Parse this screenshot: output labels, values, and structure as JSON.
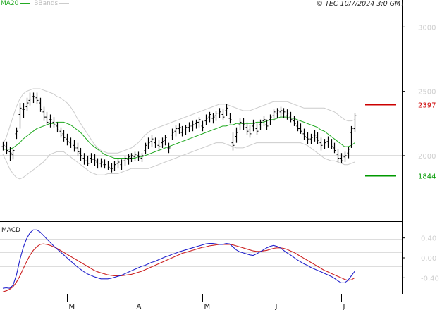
{
  "legend": {
    "ma_label": "MA20",
    "bb_label": "BBands"
  },
  "timestamp": "© TEC 10/7/2024 3:0 GMT",
  "colors": {
    "ma": "#22aa22",
    "bband": "#cccccc",
    "price": "#000000",
    "macd_line": "#2222cc",
    "signal_line": "#cc2222",
    "upper_level": "#cc0000",
    "lower_level": "#009900",
    "grid": "#dddddd"
  },
  "chart_data": [
    {
      "type": "ohlc",
      "title": "",
      "ylim": [
        14.9,
        32.1
      ],
      "yticks": [
        {
          "value": 30,
          "label": "3000"
        },
        {
          "value": 25,
          "label": "2500"
        },
        {
          "value": 20,
          "label": "2000"
        }
      ],
      "x_ticks": [
        {
          "index": 19,
          "label": "M"
        },
        {
          "index": 39,
          "label": "A"
        },
        {
          "index": 59,
          "label": "M"
        },
        {
          "index": 80,
          "label": "J"
        },
        {
          "index": 100,
          "label": "J"
        }
      ],
      "levels": [
        {
          "name": "resistance",
          "value": 23.97,
          "label": "2397",
          "color": "#cc0000"
        },
        {
          "name": "support",
          "value": 18.44,
          "label": "1844",
          "color": "#009900"
        }
      ],
      "ohlc": [
        [
          20.7,
          21.1,
          20.4,
          20.8
        ],
        [
          20.7,
          21.1,
          20.1,
          20.4
        ],
        [
          20.3,
          20.7,
          19.6,
          20.2
        ],
        [
          20.1,
          20.5,
          19.7,
          20.4
        ],
        [
          21.7,
          22.2,
          21.3,
          21.9
        ],
        [
          23.2,
          24.1,
          22.1,
          23.7
        ],
        [
          23.6,
          24.1,
          22.9,
          23.6
        ],
        [
          23.8,
          24.5,
          23.5,
          24.1
        ],
        [
          24.3,
          24.9,
          23.9,
          24.4
        ],
        [
          24.6,
          24.9,
          24.1,
          24.6
        ],
        [
          24.5,
          24.9,
          24.0,
          24.3
        ],
        [
          24.1,
          24.5,
          23.4,
          23.6
        ],
        [
          23.4,
          23.8,
          22.7,
          23.0
        ],
        [
          23.0,
          23.4,
          22.4,
          22.6
        ],
        [
          22.8,
          23.2,
          22.2,
          22.8
        ],
        [
          22.6,
          23.0,
          22.2,
          22.4
        ],
        [
          22.3,
          22.6,
          21.8,
          22.0
        ],
        [
          21.9,
          22.2,
          21.4,
          21.6
        ],
        [
          21.7,
          22.0,
          21.1,
          21.4
        ],
        [
          21.3,
          21.7,
          20.8,
          21.1
        ],
        [
          21.0,
          21.4,
          20.6,
          20.9
        ],
        [
          20.8,
          21.2,
          20.3,
          20.6
        ],
        [
          20.6,
          21.0,
          20.0,
          20.3
        ],
        [
          20.2,
          20.6,
          19.6,
          20.0
        ],
        [
          19.8,
          20.2,
          19.3,
          19.6
        ],
        [
          19.6,
          20.0,
          19.2,
          19.4
        ],
        [
          19.8,
          20.2,
          19.4,
          19.7
        ],
        [
          19.7,
          20.1,
          19.2,
          19.6
        ],
        [
          19.5,
          19.8,
          19.0,
          19.2
        ],
        [
          19.4,
          19.8,
          19.1,
          19.5
        ],
        [
          19.3,
          19.7,
          19.0,
          19.3
        ],
        [
          19.2,
          19.6,
          18.9,
          19.1
        ],
        [
          19.0,
          19.4,
          18.7,
          19.0
        ],
        [
          19.2,
          19.6,
          18.8,
          19.3
        ],
        [
          19.4,
          19.8,
          19.0,
          19.5
        ],
        [
          19.3,
          19.7,
          18.9,
          19.2
        ],
        [
          19.6,
          20.0,
          19.2,
          19.8
        ],
        [
          19.7,
          20.1,
          19.3,
          19.9
        ],
        [
          19.8,
          20.2,
          19.5,
          20.0
        ],
        [
          19.9,
          20.3,
          19.6,
          20.1
        ],
        [
          20.0,
          20.3,
          19.6,
          19.9
        ],
        [
          19.8,
          20.2,
          19.5,
          20.0
        ],
        [
          20.4,
          21.0,
          20.1,
          20.8
        ],
        [
          20.9,
          21.4,
          20.5,
          21.0
        ],
        [
          21.1,
          21.6,
          20.7,
          21.3
        ],
        [
          21.0,
          21.4,
          20.6,
          20.9
        ],
        [
          20.8,
          21.2,
          20.4,
          20.7
        ],
        [
          21.0,
          21.4,
          20.6,
          21.1
        ],
        [
          21.2,
          21.6,
          20.8,
          21.4
        ],
        [
          20.6,
          21.0,
          20.2,
          20.6
        ],
        [
          21.6,
          22.1,
          21.2,
          21.8
        ],
        [
          21.9,
          22.4,
          21.5,
          22.1
        ],
        [
          22.1,
          22.5,
          21.7,
          22.2
        ],
        [
          21.8,
          22.3,
          21.5,
          22.0
        ],
        [
          22.0,
          22.4,
          21.6,
          22.2
        ],
        [
          22.2,
          22.6,
          21.8,
          22.3
        ],
        [
          22.3,
          22.7,
          21.9,
          22.4
        ],
        [
          22.5,
          22.8,
          22.1,
          22.6
        ],
        [
          22.6,
          23.0,
          22.2,
          22.8
        ],
        [
          22.3,
          22.7,
          21.9,
          22.2
        ],
        [
          22.7,
          23.2,
          22.4,
          22.9
        ],
        [
          23.0,
          23.4,
          22.6,
          23.2
        ],
        [
          22.9,
          23.3,
          22.5,
          23.0
        ],
        [
          23.1,
          23.5,
          22.7,
          23.3
        ],
        [
          23.3,
          23.7,
          22.9,
          23.4
        ],
        [
          23.2,
          23.6,
          22.8,
          23.0
        ],
        [
          23.5,
          24.0,
          23.1,
          23.7
        ],
        [
          22.9,
          23.3,
          22.5,
          22.8
        ],
        [
          21.0,
          21.8,
          20.4,
          20.8
        ],
        [
          21.5,
          22.2,
          21.0,
          21.8
        ],
        [
          22.4,
          22.9,
          22.0,
          22.6
        ],
        [
          22.5,
          22.9,
          22.0,
          22.4
        ],
        [
          22.2,
          22.6,
          21.6,
          21.9
        ],
        [
          22.0,
          22.4,
          21.4,
          21.7
        ],
        [
          22.3,
          22.8,
          21.9,
          22.5
        ],
        [
          22.1,
          22.5,
          21.6,
          21.9
        ],
        [
          22.4,
          22.8,
          22.0,
          22.6
        ],
        [
          22.7,
          23.1,
          22.3,
          22.8
        ],
        [
          22.4,
          22.8,
          22.0,
          22.3
        ],
        [
          22.8,
          23.2,
          22.4,
          23.0
        ],
        [
          23.1,
          23.6,
          22.7,
          23.4
        ],
        [
          23.3,
          23.7,
          22.9,
          23.5
        ],
        [
          23.4,
          23.8,
          23.0,
          23.5
        ],
        [
          23.3,
          23.7,
          22.9,
          23.4
        ],
        [
          23.1,
          23.6,
          22.8,
          23.3
        ],
        [
          23.0,
          23.4,
          22.6,
          22.8
        ],
        [
          22.7,
          23.1,
          22.3,
          22.5
        ],
        [
          22.3,
          22.7,
          21.9,
          22.1
        ],
        [
          22.1,
          22.5,
          21.7,
          21.9
        ],
        [
          21.7,
          22.1,
          21.2,
          21.5
        ],
        [
          21.4,
          21.8,
          20.9,
          21.3
        ],
        [
          21.3,
          21.7,
          20.9,
          21.4
        ],
        [
          21.6,
          22.0,
          21.1,
          21.6
        ],
        [
          21.4,
          21.8,
          20.9,
          21.2
        ],
        [
          21.0,
          21.4,
          20.4,
          20.8
        ],
        [
          20.9,
          21.3,
          20.5,
          21.0
        ],
        [
          21.1,
          21.5,
          20.6,
          20.9
        ],
        [
          20.9,
          21.3,
          20.5,
          20.7
        ],
        [
          20.6,
          21.0,
          20.2,
          20.4
        ],
        [
          20.1,
          20.5,
          19.5,
          19.8
        ],
        [
          19.8,
          20.2,
          19.4,
          19.6
        ],
        [
          19.9,
          20.3,
          19.5,
          20.0
        ],
        [
          20.2,
          20.7,
          19.8,
          20.5
        ],
        [
          21.8,
          22.3,
          20.6,
          22.1
        ],
        [
          22.1,
          23.3,
          21.8,
          23.1
        ]
      ],
      "ma20": [
        20.5,
        20.5,
        20.5,
        20.6,
        20.8,
        21.0,
        21.3,
        21.5,
        21.7,
        21.9,
        22.1,
        22.2,
        22.3,
        22.4,
        22.5,
        22.5,
        22.6,
        22.6,
        22.6,
        22.5,
        22.4,
        22.2,
        22.0,
        21.8,
        21.5,
        21.2,
        20.9,
        20.7,
        20.5,
        20.3,
        20.1,
        20.0,
        19.9,
        19.8,
        19.8,
        19.8,
        19.8,
        19.8,
        19.8,
        19.8,
        19.9,
        19.9,
        20.0,
        20.1,
        20.2,
        20.3,
        20.4,
        20.5,
        20.6,
        20.7,
        20.8,
        20.9,
        21.0,
        21.1,
        21.2,
        21.3,
        21.4,
        21.5,
        21.6,
        21.7,
        21.8,
        21.9,
        22.0,
        22.1,
        22.2,
        22.3,
        22.3,
        22.4,
        22.4,
        22.5,
        22.5,
        22.5,
        22.5,
        22.5,
        22.5,
        22.6,
        22.6,
        22.6,
        22.7,
        22.8,
        22.8,
        22.9,
        23.0,
        23.0,
        23.0,
        22.9,
        22.9,
        22.8,
        22.7,
        22.6,
        22.5,
        22.4,
        22.3,
        22.2,
        22.0,
        21.9,
        21.7,
        21.5,
        21.3,
        21.1,
        20.9,
        20.7,
        20.7,
        20.8,
        21.0
      ],
      "bb_upper": [
        20.9,
        21.4,
        22.2,
        23.0,
        23.8,
        24.4,
        24.8,
        25.0,
        25.1,
        25.2,
        25.2,
        25.2,
        25.1,
        25.0,
        24.9,
        24.8,
        24.6,
        24.5,
        24.3,
        24.1,
        23.8,
        23.4,
        22.9,
        22.5,
        22.1,
        21.7,
        21.3,
        20.9,
        20.6,
        20.4,
        20.3,
        20.2,
        20.2,
        20.2,
        20.2,
        20.3,
        20.4,
        20.5,
        20.6,
        20.8,
        21.0,
        21.3,
        21.6,
        21.8,
        22.0,
        22.1,
        22.2,
        22.3,
        22.4,
        22.5,
        22.6,
        22.7,
        22.8,
        22.9,
        23.0,
        23.1,
        23.2,
        23.3,
        23.4,
        23.5,
        23.6,
        23.7,
        23.8,
        23.9,
        24.0,
        24.0,
        24.0,
        23.9,
        23.8,
        23.7,
        23.6,
        23.5,
        23.5,
        23.5,
        23.6,
        23.7,
        23.8,
        23.9,
        24.0,
        24.1,
        24.2,
        24.2,
        24.2,
        24.2,
        24.2,
        24.1,
        24.0,
        23.9,
        23.8,
        23.7,
        23.7,
        23.7,
        23.7,
        23.7,
        23.7,
        23.7,
        23.6,
        23.5,
        23.4,
        23.2,
        23.0,
        22.8,
        22.7,
        22.7,
        22.8
      ],
      "bb_lower": [
        20.1,
        19.6,
        19.0,
        18.6,
        18.3,
        18.2,
        18.3,
        18.5,
        18.7,
        18.9,
        19.1,
        19.3,
        19.5,
        19.8,
        20.1,
        20.2,
        20.3,
        20.3,
        20.3,
        20.1,
        19.9,
        19.7,
        19.5,
        19.3,
        19.1,
        18.9,
        18.7,
        18.6,
        18.5,
        18.5,
        18.5,
        18.6,
        18.6,
        18.6,
        18.6,
        18.7,
        18.8,
        18.9,
        19.0,
        19.0,
        19.0,
        19.0,
        19.0,
        19.0,
        19.1,
        19.2,
        19.3,
        19.4,
        19.5,
        19.6,
        19.7,
        19.8,
        19.9,
        20.0,
        20.1,
        20.2,
        20.3,
        20.4,
        20.5,
        20.6,
        20.7,
        20.8,
        20.9,
        21.0,
        21.0,
        21.0,
        20.9,
        20.8,
        20.7,
        20.6,
        20.6,
        20.6,
        20.7,
        20.8,
        20.9,
        21.0,
        21.0,
        21.0,
        21.0,
        21.0,
        21.0,
        21.0,
        21.0,
        21.0,
        21.0,
        21.0,
        21.0,
        21.0,
        21.0,
        20.9,
        20.8,
        20.6,
        20.4,
        20.2,
        20.0,
        19.8,
        19.7,
        19.6,
        19.6,
        19.5,
        19.4,
        19.3,
        19.3,
        19.4,
        19.5
      ]
    },
    {
      "type": "line",
      "title": "MACD",
      "ylim": [
        -0.72,
        0.72
      ],
      "yticks": [
        {
          "value": 0.4,
          "label": "0.40"
        },
        {
          "value": 0,
          "label": "0.00"
        },
        {
          "value": -0.4,
          "label": "-0.40"
        }
      ],
      "series": [
        {
          "name": "macd",
          "values": [
            -0.61,
            -0.6,
            -0.61,
            -0.55,
            -0.35,
            -0.05,
            0.2,
            0.38,
            0.5,
            0.56,
            0.56,
            0.52,
            0.45,
            0.38,
            0.31,
            0.24,
            0.18,
            0.12,
            0.06,
            0.0,
            -0.06,
            -0.12,
            -0.18,
            -0.23,
            -0.28,
            -0.32,
            -0.35,
            -0.38,
            -0.4,
            -0.42,
            -0.42,
            -0.42,
            -0.41,
            -0.39,
            -0.37,
            -0.35,
            -0.32,
            -0.29,
            -0.26,
            -0.23,
            -0.2,
            -0.17,
            -0.15,
            -0.12,
            -0.09,
            -0.07,
            -0.04,
            -0.01,
            0.02,
            0.04,
            0.07,
            0.09,
            0.12,
            0.14,
            0.16,
            0.18,
            0.2,
            0.22,
            0.24,
            0.26,
            0.28,
            0.29,
            0.29,
            0.28,
            0.27,
            0.27,
            0.29,
            0.28,
            0.22,
            0.16,
            0.12,
            0.1,
            0.08,
            0.06,
            0.05,
            0.08,
            0.12,
            0.16,
            0.2,
            0.23,
            0.25,
            0.23,
            0.2,
            0.15,
            0.1,
            0.06,
            0.01,
            -0.04,
            -0.08,
            -0.12,
            -0.15,
            -0.19,
            -0.22,
            -0.25,
            -0.28,
            -0.31,
            -0.34,
            -0.37,
            -0.41,
            -0.46,
            -0.5,
            -0.5,
            -0.45,
            -0.36,
            -0.27
          ]
        },
        {
          "name": "signal",
          "values": [
            -0.68,
            -0.66,
            -0.63,
            -0.58,
            -0.49,
            -0.37,
            -0.22,
            -0.08,
            0.05,
            0.15,
            0.22,
            0.27,
            0.28,
            0.27,
            0.25,
            0.22,
            0.19,
            0.15,
            0.11,
            0.07,
            0.03,
            -0.01,
            -0.05,
            -0.09,
            -0.13,
            -0.17,
            -0.21,
            -0.25,
            -0.28,
            -0.3,
            -0.32,
            -0.34,
            -0.35,
            -0.36,
            -0.36,
            -0.36,
            -0.35,
            -0.34,
            -0.33,
            -0.31,
            -0.29,
            -0.27,
            -0.24,
            -0.21,
            -0.18,
            -0.15,
            -0.12,
            -0.09,
            -0.06,
            -0.03,
            0.0,
            0.03,
            0.06,
            0.09,
            0.11,
            0.13,
            0.15,
            0.17,
            0.19,
            0.21,
            0.22,
            0.24,
            0.25,
            0.26,
            0.27,
            0.27,
            0.27,
            0.27,
            0.26,
            0.24,
            0.22,
            0.2,
            0.18,
            0.16,
            0.14,
            0.13,
            0.13,
            0.14,
            0.15,
            0.17,
            0.19,
            0.2,
            0.2,
            0.19,
            0.17,
            0.14,
            0.11,
            0.07,
            0.03,
            -0.01,
            -0.05,
            -0.09,
            -0.13,
            -0.17,
            -0.21,
            -0.25,
            -0.28,
            -0.31,
            -0.34,
            -0.37,
            -0.4,
            -0.43,
            -0.45,
            -0.44,
            -0.4
          ]
        }
      ]
    }
  ]
}
